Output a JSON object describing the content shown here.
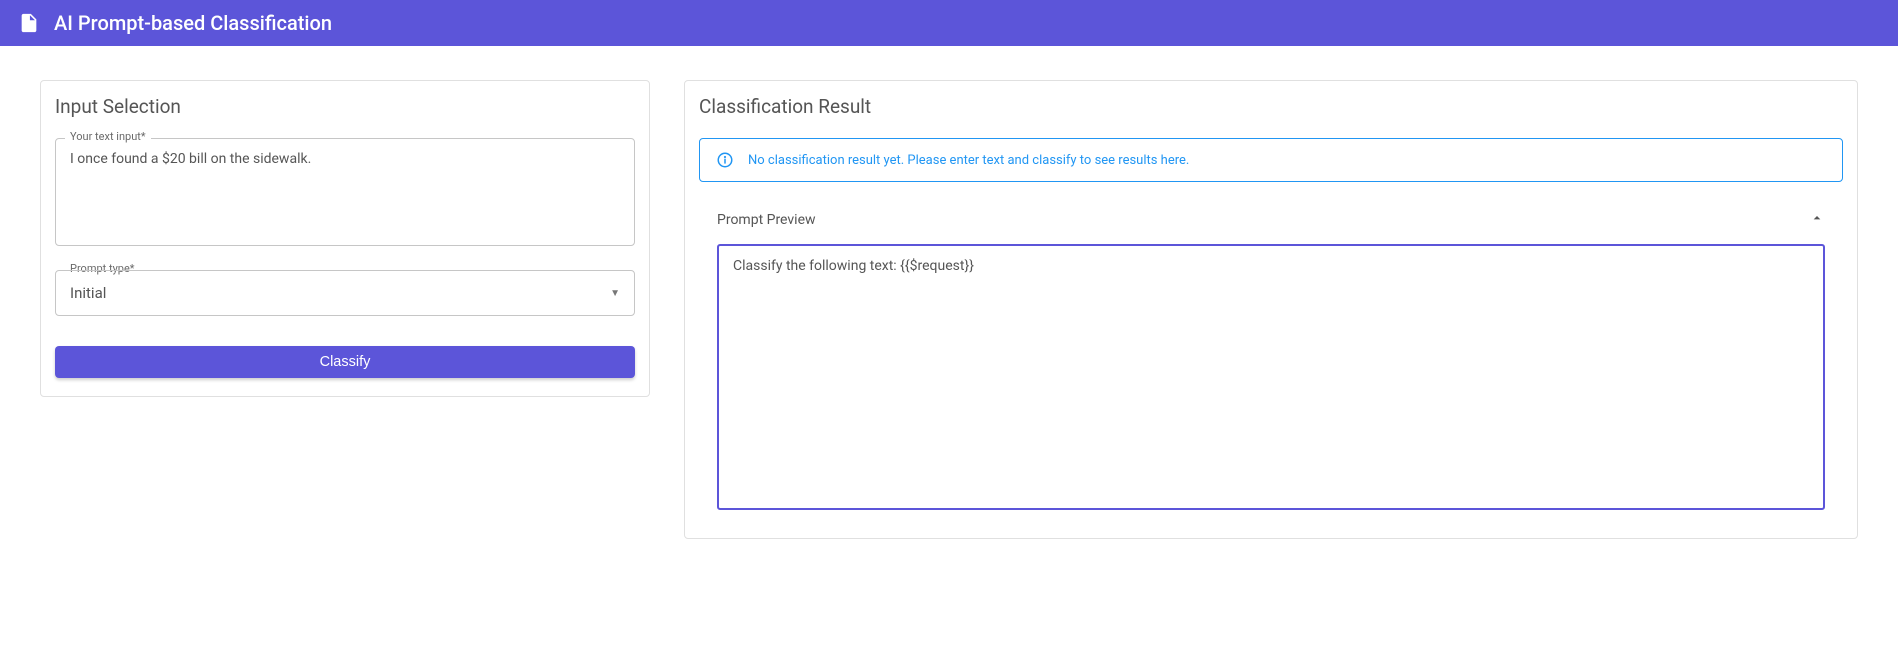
{
  "header": {
    "title": "AI Prompt-based Classification"
  },
  "inputCard": {
    "title": "Input Selection",
    "textInputLabel": "Your text input*",
    "textInputValue": "I once found a $20 bill on the sidewalk.",
    "promptTypeLabel": "Prompt type*",
    "promptTypeValue": "Initial",
    "classifyButtonLabel": "Classify"
  },
  "resultCard": {
    "title": "Classification Result",
    "infoMessage": "No classification result yet. Please enter text and classify to see results here.",
    "promptPreviewLabel": "Prompt Preview",
    "promptPreviewContent": "Classify the following text: {{$request}}"
  }
}
